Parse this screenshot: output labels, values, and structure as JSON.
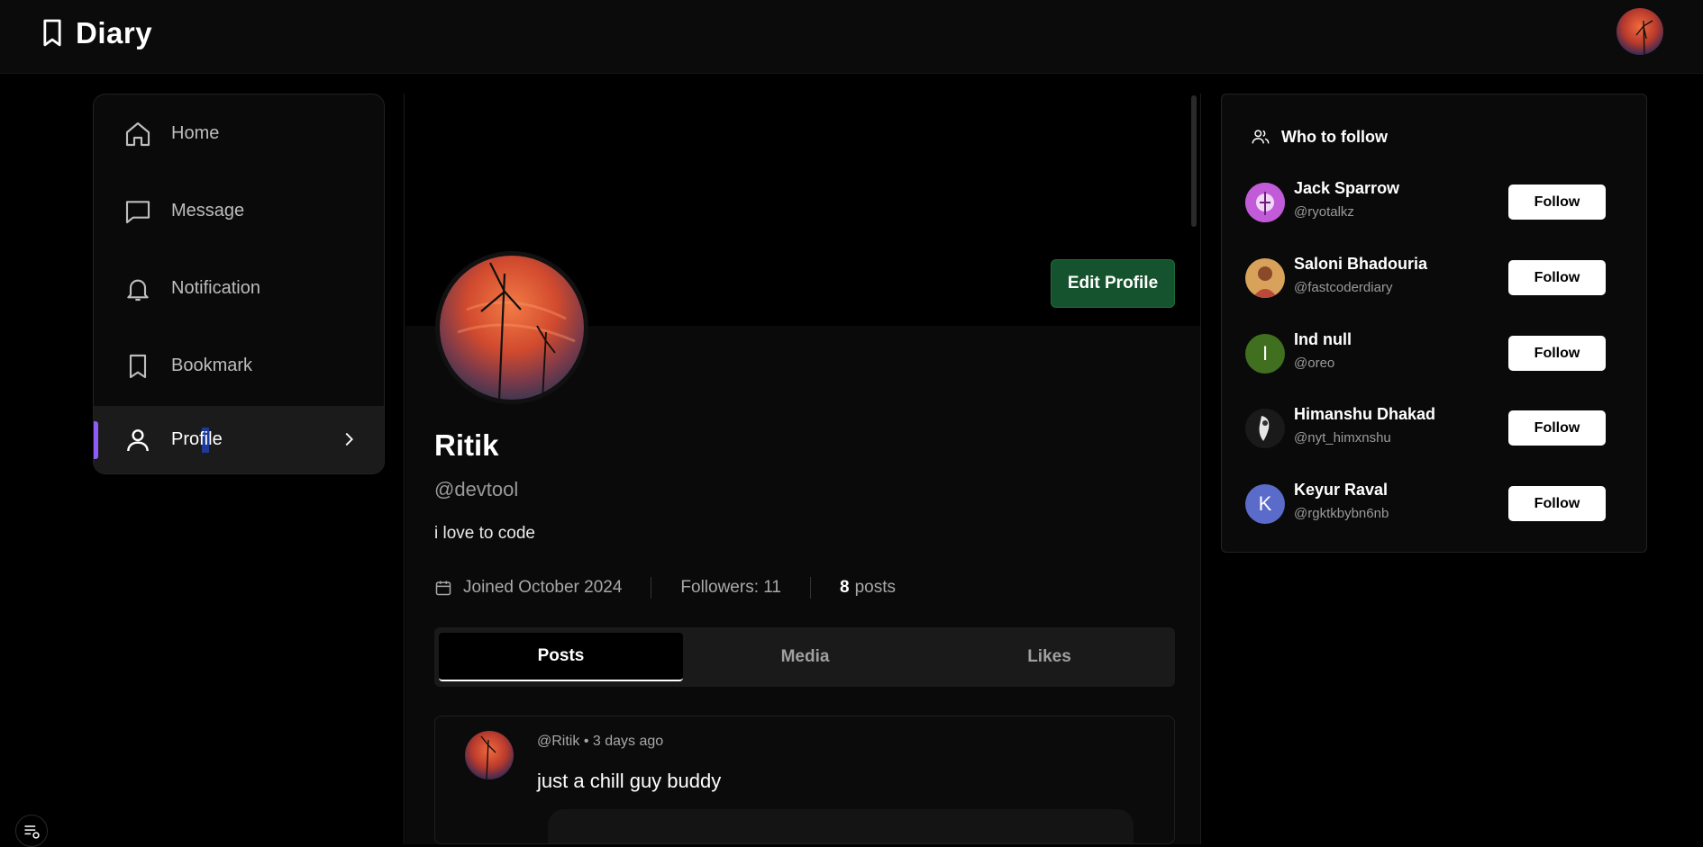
{
  "header": {
    "brand": "Diary",
    "brand_icon": "bookmark-icon",
    "user_avatar": "user-avatar"
  },
  "sidebar": {
    "items": [
      {
        "label": "Home",
        "icon": "home-icon"
      },
      {
        "label": "Message",
        "icon": "message-icon"
      },
      {
        "label": "Notification",
        "icon": "bell-icon"
      },
      {
        "label": "Bookmark",
        "icon": "bookmark-icon"
      },
      {
        "label": "Profile",
        "icon": "user-icon",
        "active": true
      }
    ],
    "active_accent": "#8b5cf6"
  },
  "profile": {
    "name": "Ritik",
    "handle": "@devtool",
    "bio": "i love to code",
    "joined": "Joined October 2024",
    "followers": "Followers: 11",
    "posts_count": "8",
    "posts_label": "posts",
    "edit_button": "Edit Profile",
    "edit_button_color": "#14532d"
  },
  "tabs": [
    {
      "label": "Posts",
      "active": true
    },
    {
      "label": "Media",
      "active": false
    },
    {
      "label": "Likes",
      "active": false
    }
  ],
  "post": {
    "author": "@Ritik",
    "separator": "•",
    "time": "3 days ago",
    "text": "just a chill guy buddy"
  },
  "who_to_follow": {
    "title": "Who to follow",
    "follow_label": "Follow",
    "users": [
      {
        "name": "Jack Sparrow",
        "handle": "@ryotalkz",
        "avatar": ""
      },
      {
        "name": "Saloni Bhadouria",
        "handle": "@fastcoderdiary",
        "avatar": ""
      },
      {
        "name": "Ind null",
        "handle": "@oreo",
        "avatar": "I",
        "avatar_color": "#3f6f1f"
      },
      {
        "name": "Himanshu Dhakad",
        "handle": "@nyt_himxnshu",
        "avatar": ""
      },
      {
        "name": "Keyur Raval",
        "handle": "@rgktkbybn6nb",
        "avatar": "K",
        "avatar_color": "#5b6bc9"
      }
    ]
  }
}
